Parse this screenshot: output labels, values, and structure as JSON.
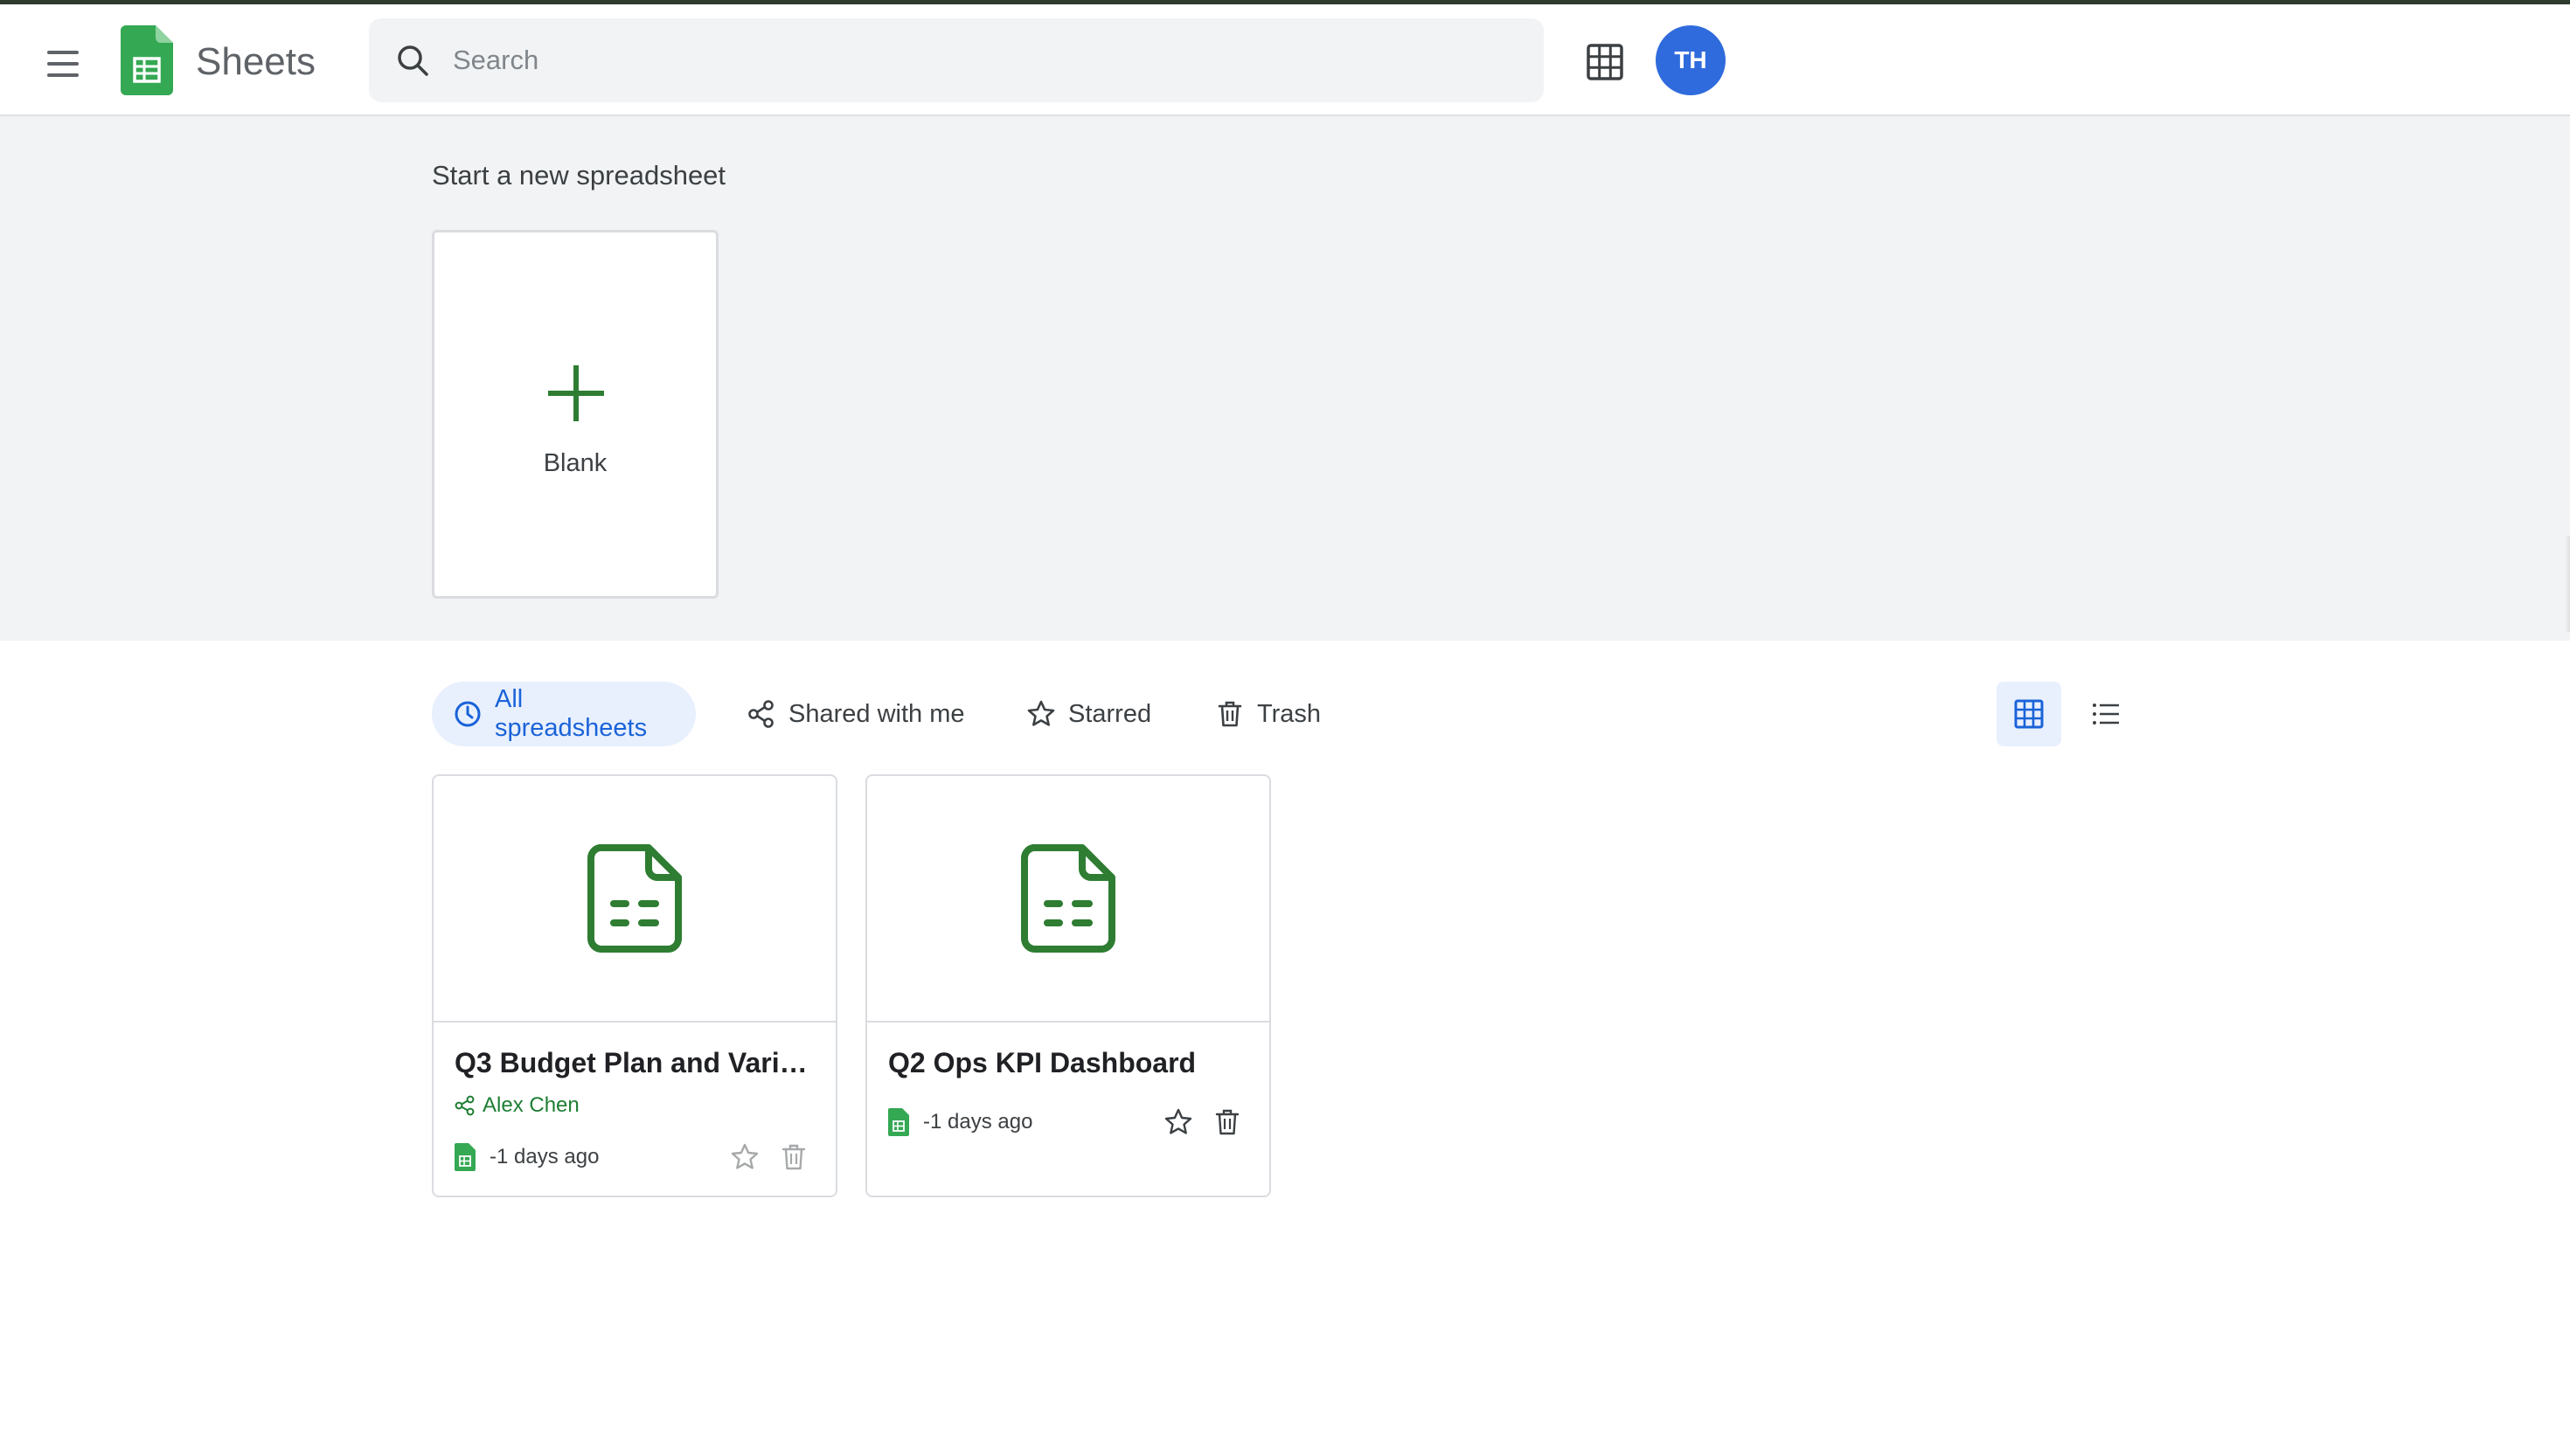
{
  "header": {
    "app_title": "Sheets",
    "search_placeholder": "Search",
    "avatar_initials": "TH",
    "menu_icon": "hamburger-menu-icon",
    "apps_icon": "apps-grid-icon"
  },
  "templates": {
    "section_title": "Start a new spreadsheet",
    "blank_label": "Blank"
  },
  "filters": {
    "all": "All spreadsheets",
    "shared": "Shared with me",
    "starred": "Starred",
    "trash": "Trash",
    "active": "all"
  },
  "view": {
    "mode": "grid"
  },
  "files": [
    {
      "title": "Q3 Budget Plan and Varian…",
      "owner": "Alex Chen",
      "shared": true,
      "modified": "-1 days ago"
    },
    {
      "title": "Q2 Ops KPI Dashboard",
      "owner": "",
      "shared": false,
      "modified": "-1 days ago"
    }
  ],
  "colors": {
    "brand_green": "#34a853",
    "icon_green": "#2e7d32",
    "accent_blue": "#1a63d8",
    "avatar_blue": "#2f6bdc",
    "band_gray": "#f1f3f4"
  }
}
